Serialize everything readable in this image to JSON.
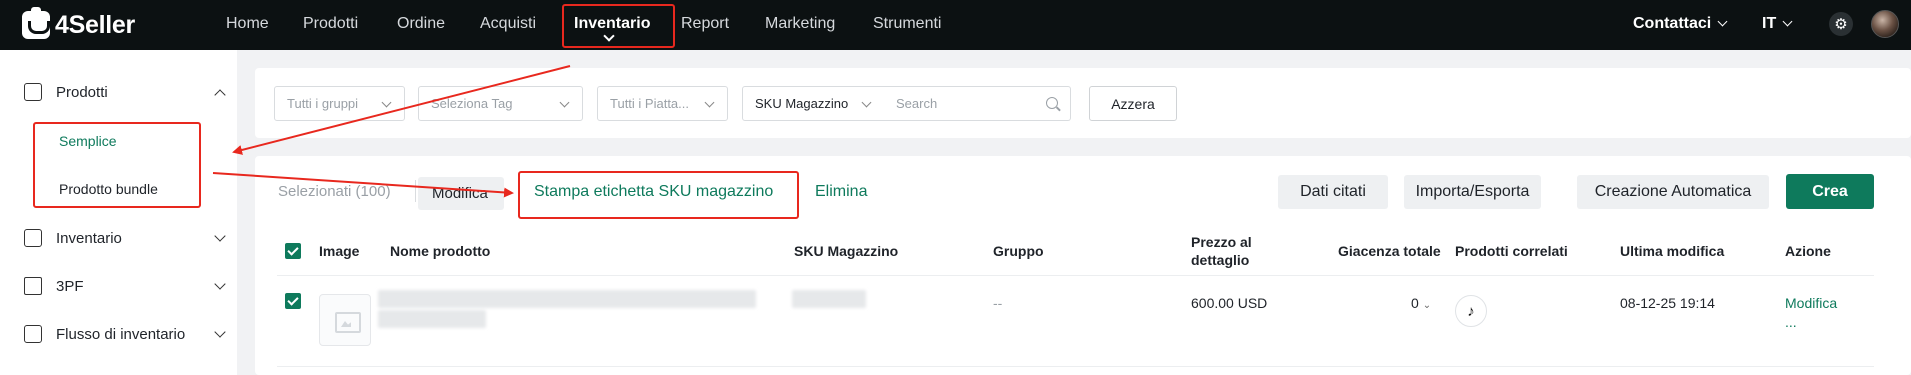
{
  "app": {
    "logo_text": "4Seller"
  },
  "nav": {
    "items": [
      {
        "label": "Home"
      },
      {
        "label": "Prodotti"
      },
      {
        "label": "Ordine"
      },
      {
        "label": "Acquisti"
      },
      {
        "label": "Inventario"
      },
      {
        "label": "Report"
      },
      {
        "label": "Marketing"
      },
      {
        "label": "Strumenti"
      }
    ],
    "active": "Inventario",
    "contact_label": "Contattaci",
    "language_label": "IT"
  },
  "sidebar": {
    "sections": [
      {
        "label": "Prodotti",
        "expanded": true,
        "icon": "box-icon",
        "children": [
          {
            "label": "Semplice",
            "active": true
          },
          {
            "label": "Prodotto bundle"
          }
        ]
      },
      {
        "label": "Inventario",
        "icon": "warehouse-icon"
      },
      {
        "label": "3PF",
        "icon": "cube-icon"
      },
      {
        "label": "Flusso di inventario",
        "icon": "flow-icon"
      }
    ]
  },
  "filters": {
    "group_placeholder": "Tutti i gruppi",
    "tag_placeholder": "Seleziona Tag",
    "platform_placeholder": "Tutti i Piatta...",
    "sku_field_selected": "SKU Magazzino",
    "search_placeholder": "Search",
    "reset_label": "Azzera"
  },
  "toolbar": {
    "selected_text": "Selezionati (100)",
    "modify_label": "Modifica",
    "print_label": "Stampa etichetta SKU magazzino",
    "delete_label": "Elimina",
    "quoted_data_label": "Dati citati",
    "import_export_label": "Importa/Esporta",
    "auto_create_label": "Creazione Automatica",
    "create_label": "Crea"
  },
  "table": {
    "headers": {
      "image": "Image",
      "name": "Nome prodotto",
      "sku": "SKU Magazzino",
      "group": "Gruppo",
      "price_line1": "Prezzo al",
      "price_line2": "dettaglio",
      "stock": "Giacenza totale",
      "related": "Prodotti correlati",
      "updated": "Ultima modifica",
      "action": "Azione"
    },
    "rows": [
      {
        "group": "--",
        "price": "600.00 USD",
        "stock": "0",
        "related_icon": "tiktok-icon",
        "updated": "08-12-25 19:14",
        "action": "Modifica",
        "more": "..."
      }
    ]
  },
  "colors": {
    "accent": "#0e7a5c",
    "topbar": "#0c1112",
    "annotation": "#e8281e"
  }
}
